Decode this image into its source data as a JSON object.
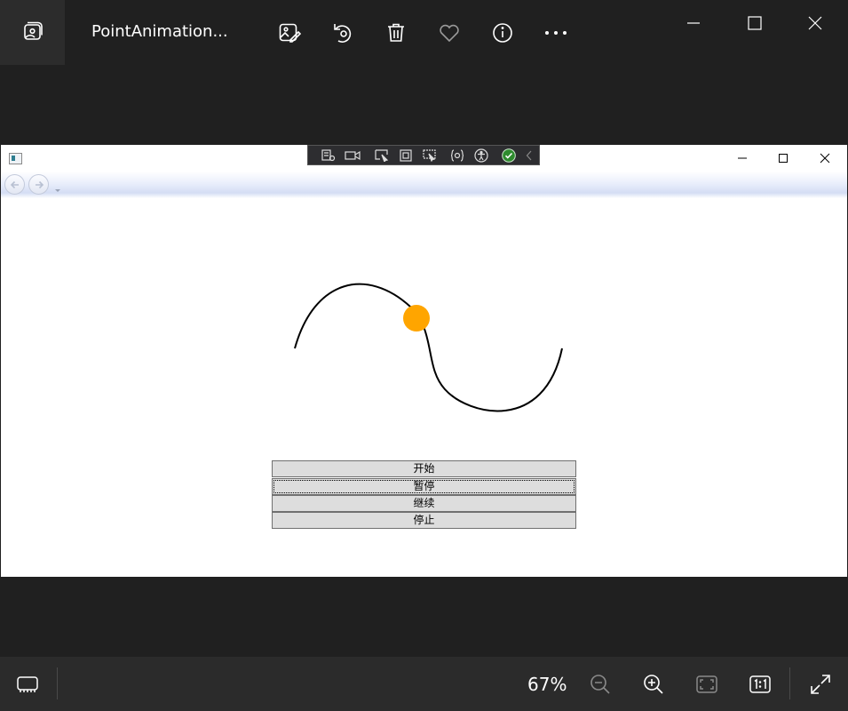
{
  "viewer": {
    "title": "PointAnimation...",
    "zoom": "67%",
    "toolbar_icons": [
      "edit-image-icon",
      "rotate-icon",
      "delete-icon",
      "favorite-icon",
      "info-icon",
      "more-icon"
    ]
  },
  "inner_window": {
    "buttons": [
      {
        "label": "开始",
        "focused": false
      },
      {
        "label": "暂停",
        "focused": true
      },
      {
        "label": "继续",
        "focused": false
      },
      {
        "label": "停止",
        "focused": false
      }
    ],
    "animation": {
      "path_stroke": "#000000",
      "point_color": "#FFA500"
    }
  },
  "colors": {
    "viewer_background": "#202020",
    "bottom_bar": "#2b2b2b",
    "button_face": "#dddddd"
  }
}
